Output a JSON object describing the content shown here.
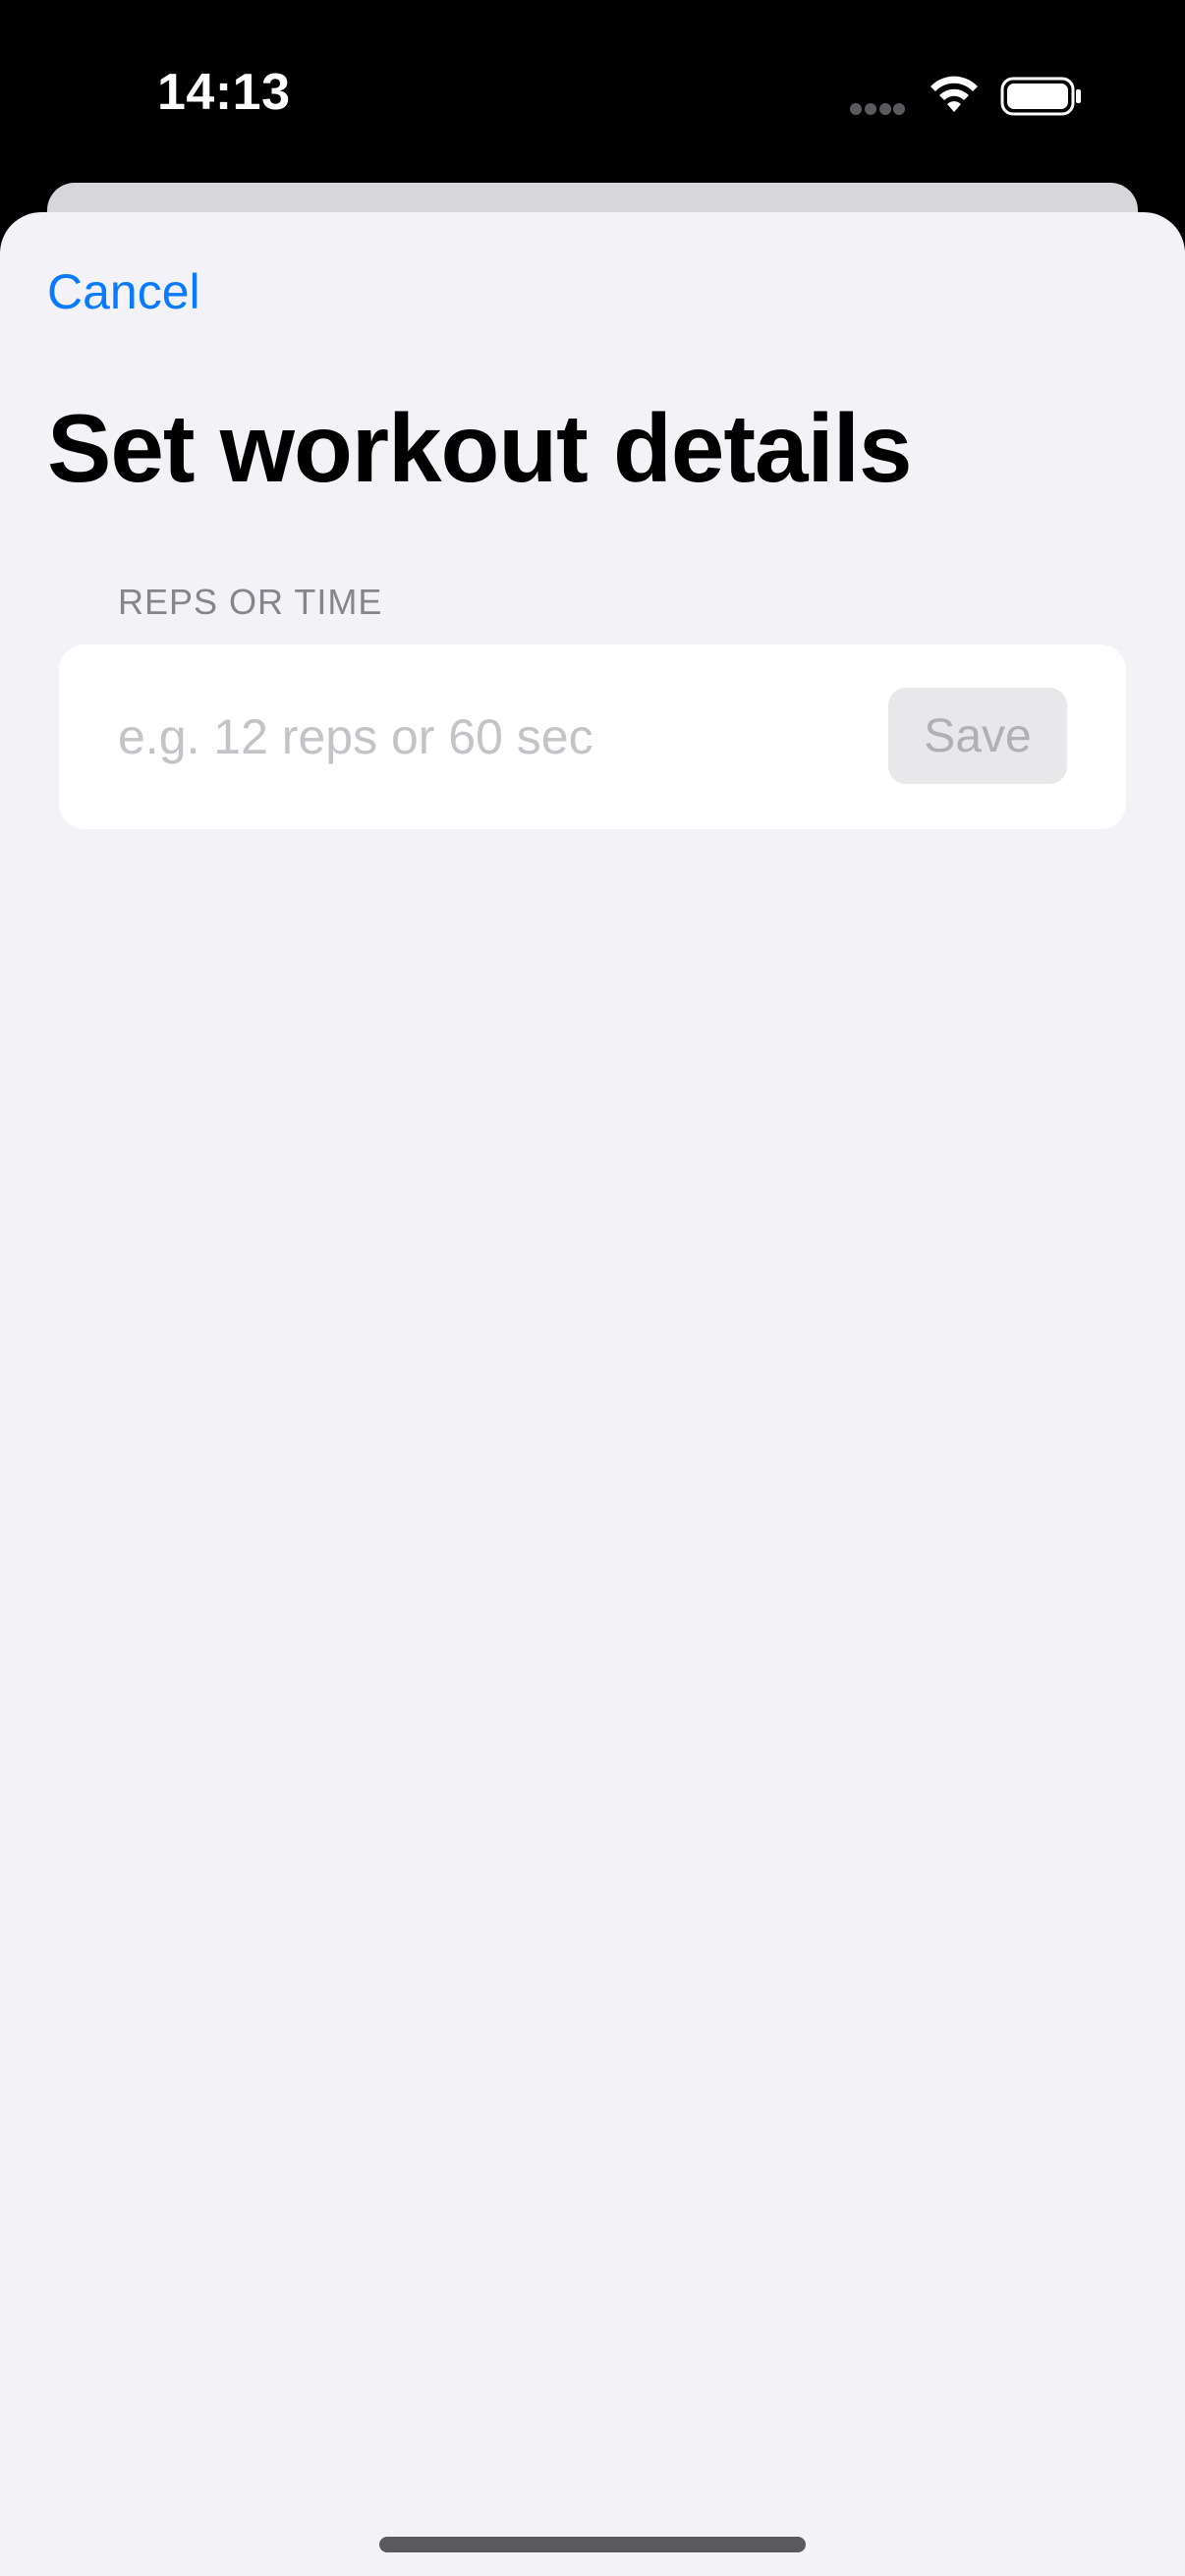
{
  "status_bar": {
    "time": "14:13",
    "icons": [
      "signal-dots-icon",
      "wifi-icon",
      "battery-icon"
    ]
  },
  "sheet": {
    "cancel_label": "Cancel",
    "title": "Set workout details",
    "section_header": "REPS OR TIME",
    "input": {
      "value": "",
      "placeholder": "e.g. 12 reps or 60 sec"
    },
    "save_label": "Save",
    "save_enabled": false
  },
  "colors": {
    "accent": "#0a7aff",
    "sheet_background": "#f2f2f7",
    "card_background": "#ffffff",
    "section_header_text": "#85858b",
    "placeholder_text": "#c3c3c8",
    "disabled_button_bg": "#e8e8ea",
    "disabled_button_text": "#b0b0b5"
  }
}
